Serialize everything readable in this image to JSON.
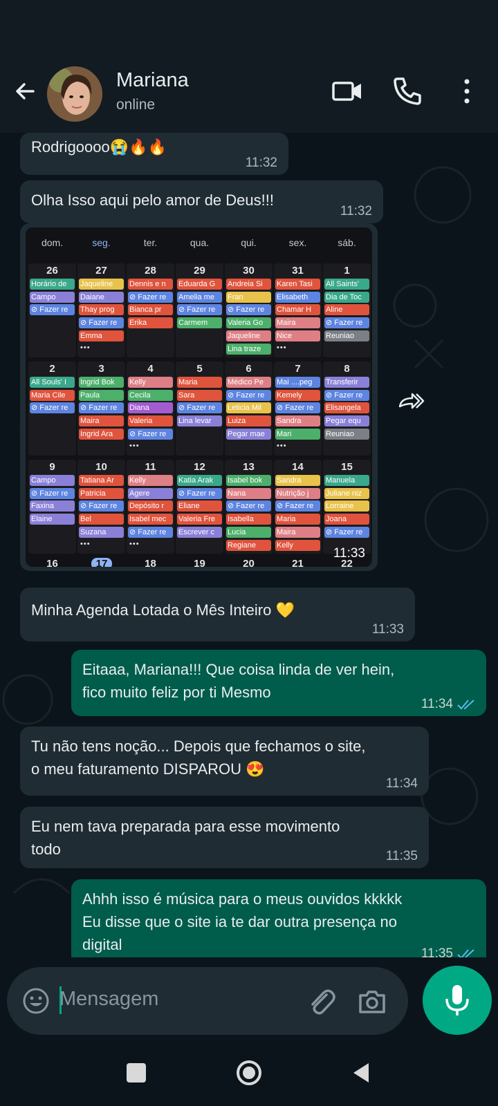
{
  "header": {
    "contact_name": "Mariana",
    "contact_status": "online"
  },
  "messages": [
    {
      "id": "m1",
      "direction": "in",
      "text": "Rodrigoooo😭🔥🔥",
      "time": "11:32"
    },
    {
      "id": "m2",
      "direction": "in",
      "text": "Olha Isso aqui pelo amor de Deus!!!",
      "time": "11:32"
    },
    {
      "id": "m4",
      "direction": "in",
      "text": "Minha Agenda Lotada o Mês Inteiro 💛",
      "time": "11:33"
    },
    {
      "id": "m5",
      "direction": "out",
      "text": "Eitaaa, Mariana!!! Que coisa linda de ver hein,\nfico muito feliz por ti Mesmo",
      "time": "11:34"
    },
    {
      "id": "m6",
      "direction": "in",
      "text": "Tu não tens noção... Depois que fechamos o site,\no meu faturamento DISPAROU 😍",
      "time": "11:34"
    },
    {
      "id": "m7",
      "direction": "in",
      "text": "Eu nem tava preparada para esse movimento\ntodo",
      "time": "11:35"
    },
    {
      "id": "m8",
      "direction": "out",
      "text": "Ahhh isso é música para o meus ouvidos kkkkk\nEu disse que o site ia te dar outra presença no\ndigital",
      "time": "11:35"
    }
  ],
  "calendar_image": {
    "time": "11:33",
    "weekdays": [
      "dom.",
      "seg.",
      "ter.",
      "qua.",
      "qui.",
      "sex.",
      "sáb."
    ],
    "selected_weekday": 1,
    "colors": {
      "teal": "#3aa88a",
      "purple": "#8a80d8",
      "blue": "#5d84e0",
      "yellow": "#e8c24a",
      "red": "#e0533c",
      "pink": "#de7f85",
      "green": "#4caf6a",
      "gray": "#7b7f86",
      "violet": "#a35bd1",
      "orange": "#f07f3c"
    },
    "weeks": [
      [
        {
          "day": "26",
          "events": [
            [
              "Horário de",
              "teal"
            ],
            [
              "Campo",
              "purple"
            ],
            [
              "⊘ Fazer re",
              "blue"
            ]
          ]
        },
        {
          "day": "27",
          "events": [
            [
              "Jaqueline",
              "yellow"
            ],
            [
              "Daiane",
              "purple"
            ],
            [
              "Thay prog",
              "red"
            ],
            [
              "⊘ Fazer re",
              "blue"
            ],
            [
              "Emma",
              "red"
            ]
          ],
          "more": "•••"
        },
        {
          "day": "28",
          "events": [
            [
              "Dennis e n",
              "red"
            ],
            [
              "⊘ Fazer re",
              "blue"
            ],
            [
              "Bianca  pr",
              "red"
            ],
            [
              "Erika",
              "red"
            ]
          ]
        },
        {
          "day": "29",
          "events": [
            [
              "Eduarda G",
              "red"
            ],
            [
              "Amelia me",
              "blue"
            ],
            [
              "⊘ Fazer re",
              "blue"
            ],
            [
              "Carmem",
              "green"
            ]
          ]
        },
        {
          "day": "30",
          "events": [
            [
              "Andreia Si",
              "red"
            ],
            [
              "Fran",
              "yellow"
            ],
            [
              "⊘ Fazer re",
              "blue"
            ],
            [
              "Valeria Go",
              "green"
            ],
            [
              "Jaqueline",
              "pink"
            ],
            [
              "Lina traze",
              "green"
            ]
          ]
        },
        {
          "day": "31",
          "events": [
            [
              "Karen Tasi",
              "red"
            ],
            [
              "Elisabeth",
              "blue"
            ],
            [
              "Chamar H",
              "red"
            ],
            [
              "Maira",
              "pink"
            ],
            [
              "Nice",
              "pink"
            ]
          ],
          "more": "•••"
        },
        {
          "day": "1",
          "events": [
            [
              "All Saints'",
              "teal"
            ],
            [
              "Dia de Toc",
              "teal"
            ],
            [
              "Aline",
              "red"
            ],
            [
              "⊘ Fazer re",
              "blue"
            ],
            [
              "Reuniao",
              "gray"
            ]
          ]
        }
      ],
      [
        {
          "day": "2",
          "events": [
            [
              "All Souls' I",
              "teal"
            ],
            [
              "Maria Cile",
              "red"
            ],
            [
              "⊘ Fazer re",
              "blue"
            ]
          ]
        },
        {
          "day": "3",
          "events": [
            [
              "Ingrid Bok",
              "green"
            ],
            [
              "Paula",
              "green"
            ],
            [
              "⊘ Fazer re",
              "blue"
            ],
            [
              "Maira",
              "red"
            ],
            [
              "Ingrid Ara",
              "red"
            ]
          ]
        },
        {
          "day": "4",
          "events": [
            [
              "Kelly",
              "pink"
            ],
            [
              "Cecila",
              "green"
            ],
            [
              "Diana",
              "violet"
            ],
            [
              "Valeria",
              "red"
            ],
            [
              "⊘ Fazer re",
              "blue"
            ]
          ],
          "more": "•••"
        },
        {
          "day": "5",
          "events": [
            [
              "Maria",
              "red"
            ],
            [
              "Sara",
              "red"
            ],
            [
              "⊘ Fazer re",
              "blue"
            ],
            [
              "Lina levar",
              "purple"
            ]
          ]
        },
        {
          "day": "6",
          "events": [
            [
              "Médico Pe",
              "pink"
            ],
            [
              "⊘ Fazer re",
              "blue"
            ],
            [
              "Leticia Mil",
              "yellow"
            ],
            [
              "Luiza",
              "red"
            ],
            [
              "Pegar mae",
              "purple"
            ]
          ]
        },
        {
          "day": "7",
          "events": [
            [
              "Mai ....peg",
              "blue"
            ],
            [
              "Kemely",
              "red"
            ],
            [
              "⊘ Fazer re",
              "blue"
            ],
            [
              "Sandra",
              "pink"
            ],
            [
              "Mari",
              "green"
            ]
          ],
          "more": "•••"
        },
        {
          "day": "8",
          "events": [
            [
              "Transferir",
              "purple"
            ],
            [
              "⊘ Fazer re",
              "blue"
            ],
            [
              "Elisangela",
              "red"
            ],
            [
              "Pegar equ",
              "purple"
            ],
            [
              "Reuniao",
              "gray"
            ]
          ]
        }
      ],
      [
        {
          "day": "9",
          "events": [
            [
              "Campo",
              "purple"
            ],
            [
              "⊘ Fazer re",
              "blue"
            ],
            [
              "Faxina",
              "purple"
            ],
            [
              "Elaine",
              "purple"
            ]
          ]
        },
        {
          "day": "10",
          "events": [
            [
              "Tatiana Ar",
              "red"
            ],
            [
              "Patricia",
              "red"
            ],
            [
              "⊘ Fazer re",
              "blue"
            ],
            [
              "Bel",
              "red"
            ],
            [
              "Suzana",
              "purple"
            ]
          ],
          "more": "•••"
        },
        {
          "day": "11",
          "events": [
            [
              "Kelly",
              "pink"
            ],
            [
              "Agere",
              "purple"
            ],
            [
              "Depósito r",
              "red"
            ],
            [
              "Isabel mec",
              "red"
            ],
            [
              "⊘ Fazer re",
              "blue"
            ]
          ],
          "more": "•••"
        },
        {
          "day": "12",
          "events": [
            [
              "Katia Arak",
              "teal"
            ],
            [
              "⊘ Fazer re",
              "blue"
            ],
            [
              "Eliane",
              "red"
            ],
            [
              "Valeria Fre",
              "red"
            ],
            [
              "Escrever c",
              "purple"
            ]
          ]
        },
        {
          "day": "13",
          "events": [
            [
              "Isabel bok",
              "green"
            ],
            [
              "Nana",
              "pink"
            ],
            [
              "⊘ Fazer re",
              "blue"
            ],
            [
              "Isabella",
              "red"
            ],
            [
              "Lucia",
              "green"
            ],
            [
              "Regiane",
              "red"
            ]
          ]
        },
        {
          "day": "14",
          "events": [
            [
              "Sandra",
              "yellow"
            ],
            [
              "Nutrição  j",
              "pink"
            ],
            [
              "⊘ Fazer re",
              "blue"
            ],
            [
              "Maria",
              "red"
            ],
            [
              "Maira",
              "pink"
            ],
            [
              "Kelly",
              "red"
            ]
          ]
        },
        {
          "day": "15",
          "events": [
            [
              "Manuela",
              "teal"
            ],
            [
              "Juliane niz",
              "yellow"
            ],
            [
              "Lorraine",
              "yellow"
            ],
            [
              "Joana",
              "red"
            ],
            [
              "⊘ Fazer re",
              "blue"
            ]
          ]
        }
      ]
    ],
    "next_week_days": [
      "16",
      "17",
      "18",
      "19",
      "20",
      "21",
      "22"
    ]
  },
  "input": {
    "placeholder": "Mensagem"
  }
}
